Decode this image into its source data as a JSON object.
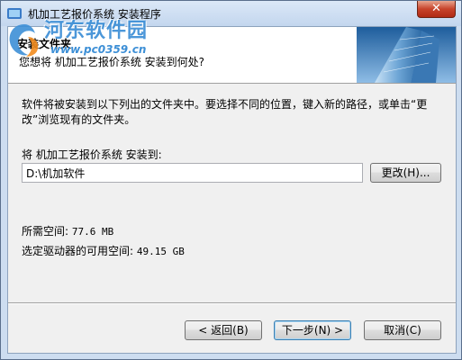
{
  "window": {
    "title": "机加工艺报价系统 安装程序",
    "close_label": "✕"
  },
  "watermark": {
    "text": "河东软件园",
    "url": "www.pc0359.cn"
  },
  "header": {
    "title": "安装文件夹",
    "subtitle": "您想将 机加工艺报价系统 安装到何处?"
  },
  "body": {
    "description": "软件将被安装到以下列出的文件夹中。要选择不同的位置，键入新的路径，或单击“更改”浏览现有的文件夹。",
    "destination_label": "将 机加工艺报价系统 安装到:",
    "destination_path": "D:\\机加软件",
    "change_button": "更改(H)...",
    "space_required_label": "所需空间:",
    "space_required_value": "77.6 MB",
    "space_available_label": "选定驱动器的可用空间:",
    "space_available_value": "49.15 GB"
  },
  "buttons": {
    "back": "< 返回(B)",
    "next": "下一步(N) >",
    "cancel": "取消(C)"
  },
  "colors": {
    "title_bar": "#c3d6ee",
    "watermark": "#3d8fd6",
    "close_button": "#c7432a",
    "client_bg": "#f0f0f0"
  }
}
